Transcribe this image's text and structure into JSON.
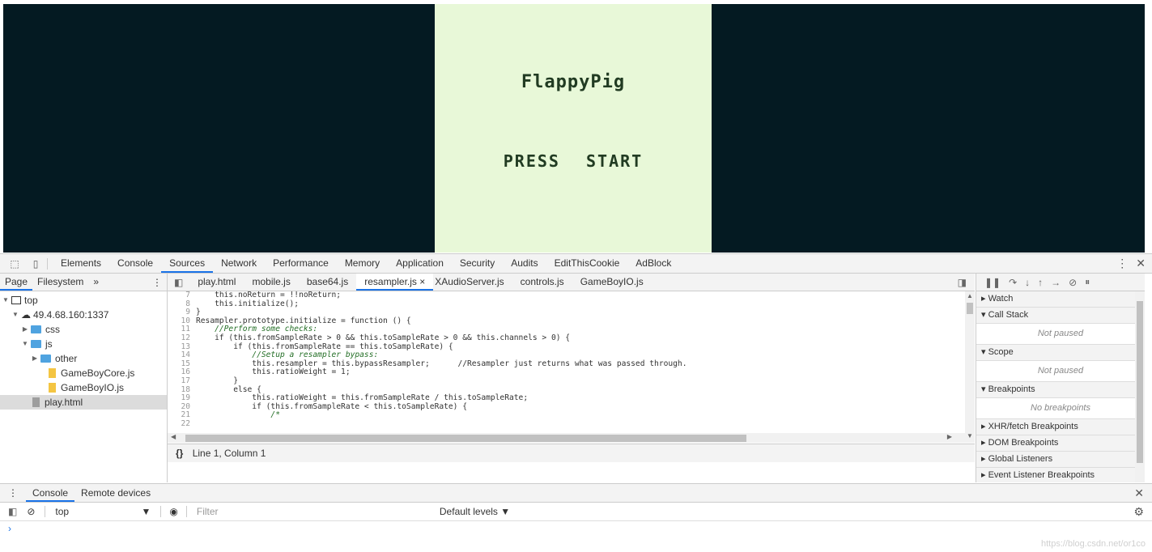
{
  "game": {
    "title": "FlappyPig",
    "prompt": "PRESS START",
    "colors": {
      "outer_bg": "#041a22",
      "screen_bg": "#e8f8d8",
      "text": "#213b22"
    }
  },
  "devtools": {
    "main_tabs": [
      "Elements",
      "Console",
      "Sources",
      "Network",
      "Performance",
      "Memory",
      "Application",
      "Security",
      "Audits",
      "EditThisCookie",
      "AdBlock"
    ],
    "active_tab": "Sources",
    "navigator": {
      "tabs": [
        "Page",
        "Filesystem"
      ],
      "more": "»",
      "tree": [
        {
          "label": "top",
          "type": "frame"
        },
        {
          "label": "49.4.68.160:1337",
          "type": "origin"
        },
        {
          "label": "css",
          "type": "folder"
        },
        {
          "label": "js",
          "type": "folder"
        },
        {
          "label": "other",
          "type": "folder"
        },
        {
          "label": "GameBoyCore.js",
          "type": "js"
        },
        {
          "label": "GameBoyIO.js",
          "type": "js"
        },
        {
          "label": "play.html",
          "type": "html"
        }
      ]
    },
    "editor": {
      "files": [
        "play.html",
        "mobile.js",
        "base64.js",
        "resampler.js",
        "XAudioServer.js",
        "controls.js",
        "GameBoyIO.js"
      ],
      "active_file": "resampler.js",
      "close_glyph": "×",
      "status": "Line 1, Column 1",
      "pretty_print": "{}",
      "lines": [
        {
          "n": "7",
          "t": "    this.noReturn = !!noReturn;"
        },
        {
          "n": "8",
          "t": "    this.initialize();"
        },
        {
          "n": "9",
          "t": "}"
        },
        {
          "n": "10",
          "t": "Resampler.prototype.initialize = function () {"
        },
        {
          "n": "11",
          "t": "    //Perform some checks:"
        },
        {
          "n": "12",
          "t": "    if (this.fromSampleRate > 0 && this.toSampleRate > 0 && this.channels > 0) {"
        },
        {
          "n": "13",
          "t": "        if (this.fromSampleRate == this.toSampleRate) {"
        },
        {
          "n": "14",
          "t": "            //Setup a resampler bypass:"
        },
        {
          "n": "15",
          "t": "            this.resampler = this.bypassResampler;      //Resampler just returns what was passed through."
        },
        {
          "n": "16",
          "t": "            this.ratioWeight = 1;"
        },
        {
          "n": "17",
          "t": "        }"
        },
        {
          "n": "18",
          "t": "        else {"
        },
        {
          "n": "19",
          "t": "            this.ratioWeight = this.fromSampleRate / this.toSampleRate;"
        },
        {
          "n": "20",
          "t": "            if (this.fromSampleRate < this.toSampleRate) {"
        },
        {
          "n": "21",
          "t": "                /*"
        },
        {
          "n": "22",
          "t": ""
        }
      ]
    },
    "debugger": {
      "panes": [
        {
          "title": "Watch",
          "open": false,
          "body": ""
        },
        {
          "title": "Call Stack",
          "open": true,
          "body": "Not paused"
        },
        {
          "title": "Scope",
          "open": true,
          "body": "Not paused"
        },
        {
          "title": "Breakpoints",
          "open": true,
          "body": "No breakpoints"
        },
        {
          "title": "XHR/fetch Breakpoints",
          "open": false,
          "body": ""
        },
        {
          "title": "DOM Breakpoints",
          "open": false,
          "body": ""
        },
        {
          "title": "Global Listeners",
          "open": false,
          "body": ""
        },
        {
          "title": "Event Listener Breakpoints",
          "open": false,
          "body": ""
        }
      ]
    },
    "drawer": {
      "tabs": [
        "Console",
        "Remote devices"
      ],
      "active": "Console",
      "context": "top",
      "filter_placeholder": "Filter",
      "levels": "Default levels ▼",
      "prompt": "›"
    },
    "watermark": "https://blog.csdn.net/or1co"
  }
}
